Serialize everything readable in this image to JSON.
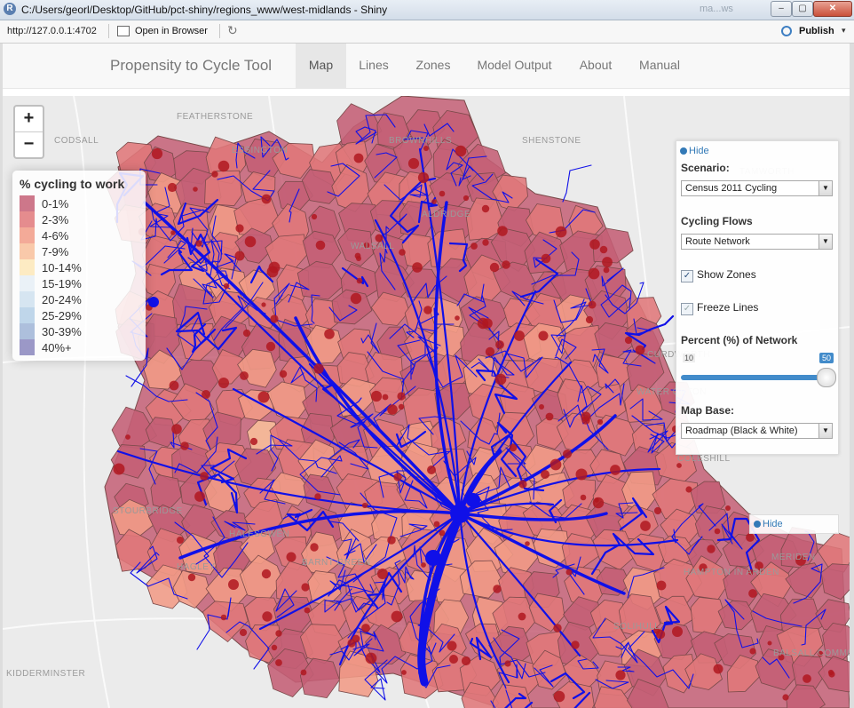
{
  "window": {
    "title": "C:/Users/georl/Desktop/GitHub/pct-shiny/regions_www/west-midlands - Shiny",
    "ghost_label": "ma...ws",
    "min_glyph": "–",
    "max_glyph": "▢",
    "close_glyph": "✕"
  },
  "toolbar": {
    "url": "http://127.0.0.1:4702",
    "open_label": "Open in Browser",
    "refresh_glyph": "↻",
    "publish_label": "Publish",
    "publish_caret": "▾"
  },
  "nav": {
    "brand": "Propensity to Cycle Tool",
    "items": [
      {
        "label": "Map",
        "active": true
      },
      {
        "label": "Lines",
        "active": false
      },
      {
        "label": "Zones",
        "active": false
      },
      {
        "label": "Model Output",
        "active": false
      },
      {
        "label": "About",
        "active": false
      },
      {
        "label": "Manual",
        "active": false
      }
    ]
  },
  "map": {
    "zoom_in": "+",
    "zoom_out": "−",
    "places": [
      "FEATHERSTONE",
      "CODSALL",
      "ESSINGTON",
      "BROWNHILLS",
      "SHENSTONE",
      "TAMWORTH",
      "LICHFIELD",
      "CURDWORTH",
      "WATER ORTON",
      "HALESOWEN",
      "HAGLEY",
      "STOURBRIDGE",
      "HAMPTON IN ARDEN",
      "MERIDEN",
      "BALSALL COMMON",
      "KIDDERMINSTER",
      "COLESHILL",
      "BARNT GREEN",
      "SOLIHULL",
      "ALDRIDGE",
      "WALSALL"
    ],
    "colors": {
      "network": "#1010e8",
      "centroid": "#b01820",
      "zone_border": "#7a4a4a"
    }
  },
  "legend": {
    "title": "% cycling to work",
    "items": [
      {
        "label": "0-1%",
        "color": "#c45f75"
      },
      {
        "label": "2-3%",
        "color": "#e0787a"
      },
      {
        "label": "4-6%",
        "color": "#f19b86"
      },
      {
        "label": "7-9%",
        "color": "#f8bf9b"
      },
      {
        "label": "10-14%",
        "color": "#fde7b8"
      },
      {
        "label": "15-19%",
        "color": "#e6eff6"
      },
      {
        "label": "20-24%",
        "color": "#cfe1ef"
      },
      {
        "label": "25-29%",
        "color": "#b4cfe6"
      },
      {
        "label": "30-39%",
        "color": "#9fb4d6"
      },
      {
        "label": "40%+",
        "color": "#8a86bd"
      }
    ]
  },
  "panel": {
    "hide_label": "Hide",
    "scenario_label": "Scenario:",
    "scenario_value": "Census 2011 Cycling",
    "flows_label": "Cycling Flows",
    "flows_value": "Route Network",
    "show_zones_label": "Show Zones",
    "show_zones_checked": true,
    "freeze_lines_label": "Freeze Lines",
    "freeze_lines_checked": true,
    "percent_label": "Percent (%) of Network",
    "slider_min": "10",
    "slider_value": "50",
    "slider_fraction": 1.0,
    "base_label": "Map Base:",
    "base_value": "Roadmap (Black & White)",
    "check_glyph": "✓",
    "select_arrow": "▼"
  },
  "panel2": {
    "hide_label": "Hide"
  }
}
